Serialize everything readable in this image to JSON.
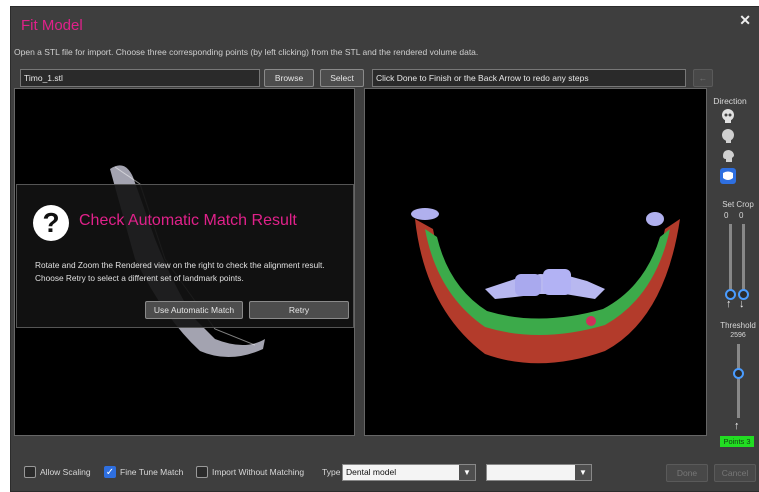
{
  "window": {
    "title": "Fit Model",
    "close_symbol": "✕"
  },
  "instructions": "Open a STL file for import.  Choose three corresponding points (by left clicking) from the STL and the rendered volume data.",
  "file_field": {
    "value": "Timo_1.stl"
  },
  "buttons": {
    "browse": "Browse",
    "select": "Select",
    "back_symbol": "←"
  },
  "status_field": {
    "value": "Click Done to Finish or the Back Arrow to redo any steps"
  },
  "dialog": {
    "icon_symbol": "?",
    "title": "Check Automatic Match Result",
    "line1": "Rotate and Zoom the Rendered view on the right to check the alignment result.",
    "line2": "Choose Retry to select a different set of landmark points.",
    "use_automatic": "Use Automatic Match",
    "retry": "Retry"
  },
  "sidebar": {
    "direction_label": "Direction",
    "direction_icons": [
      "skull-front-icon",
      "skull-side-icon",
      "head-side-icon",
      "jaw-icon"
    ],
    "set_crop_label": "Set Crop",
    "crop_values": [
      "0",
      "0"
    ],
    "threshold_label": "Threshold",
    "threshold_value": "2596",
    "points_badge": "Points 3"
  },
  "footer": {
    "allow_scaling": {
      "label": "Allow Scaling",
      "checked": false
    },
    "fine_tune": {
      "label": "Fine Tune Match",
      "checked": true
    },
    "import_without": {
      "label": "Import Without Matching",
      "checked": false
    },
    "type_label": "Type",
    "type_value": "Dental model",
    "second_select_value": "",
    "done": "Done",
    "cancel": "Cancel"
  },
  "colors": {
    "accent": "#e0218a",
    "highlight": "#2e6fe0",
    "points": "#22dd22"
  }
}
